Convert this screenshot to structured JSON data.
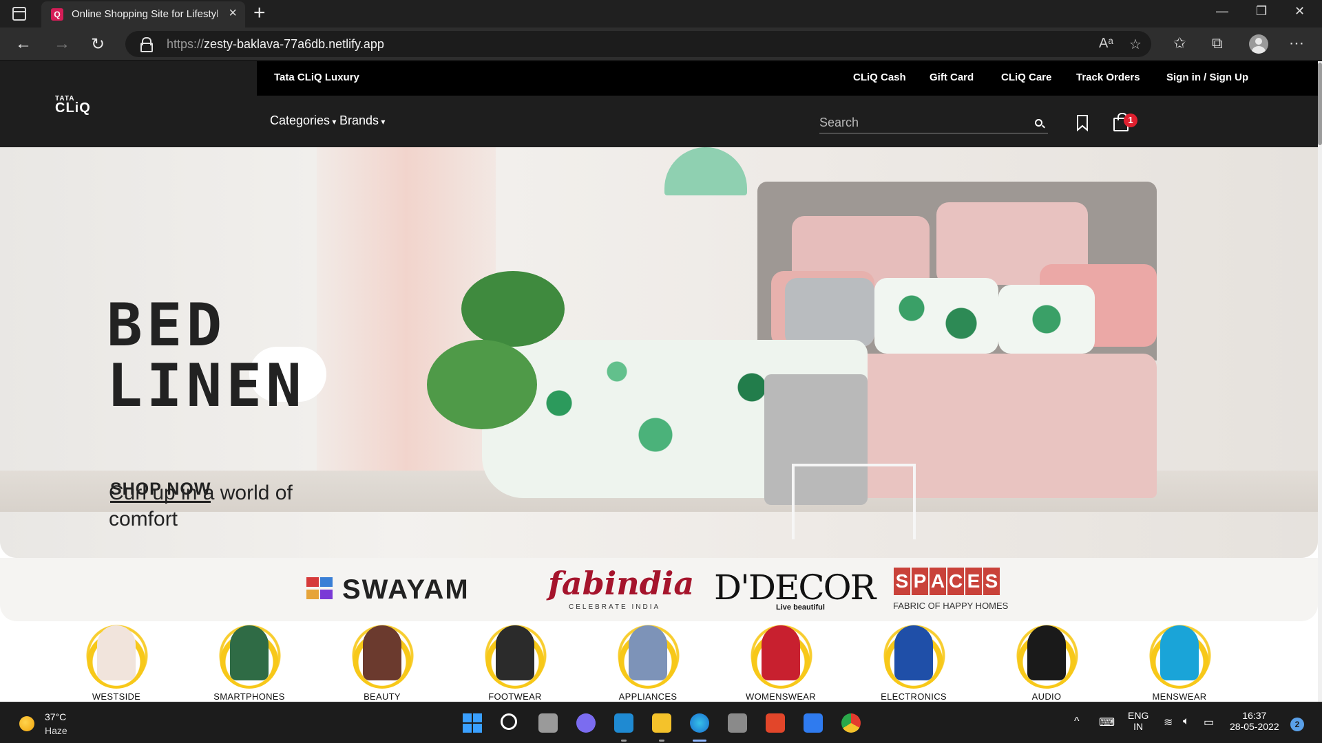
{
  "browser": {
    "tab_title": "Online Shopping Site for Lifestyle",
    "tab_close": "×",
    "new_tab": "+",
    "url_scheme": "https://",
    "url_host": "zesty-baklava-77a6db.netlify.app",
    "window_controls": {
      "minimize": "—",
      "restore": "❐",
      "close": "✕"
    },
    "nav": {
      "back": "←",
      "forward": "→",
      "reload": "↻"
    },
    "toolbar_icons": {
      "read_aloud": "Aᵃ",
      "add_favorite": "☆",
      "favorites": "✩",
      "collections": "⧉",
      "more": "⋯"
    }
  },
  "site": {
    "logo_top": "TATA",
    "logo_bottom": "CLiQ",
    "util_links": [
      "Tata CLiQ Luxury",
      "CLiQ Cash",
      "Gift Card",
      "CLiQ Care",
      "Track Orders",
      "Sign in / Sign Up"
    ],
    "nav_categories": "Categories",
    "nav_brands": "Brands",
    "search_placeholder": "Search",
    "bag_count": "1"
  },
  "hero": {
    "title_line1": "BED",
    "title_line2": "LINEN",
    "subtitle": "Curl up in a world of comfort",
    "cta": "SHOP NOW",
    "brands": {
      "swayam": "SWAYAM",
      "fabindia": "fabindia",
      "fabindia_tag": "CELEBRATE INDIA",
      "ddecor": "D'DECOR",
      "ddecor_tag": "Live beautiful",
      "spaces": [
        "S",
        "P",
        "A",
        "C",
        "E",
        "S"
      ],
      "spaces_tag": "FABRIC OF HAPPY HOMES"
    }
  },
  "categories": [
    {
      "label": "WESTSIDE",
      "color": "#f1e4dc"
    },
    {
      "label": "SMARTPHONES",
      "color": "#2f6b45"
    },
    {
      "label": "BEAUTY",
      "color": "#6b3a2e"
    },
    {
      "label": "FOOTWEAR",
      "color": "#2b2b2b"
    },
    {
      "label": "APPLIANCES",
      "color": "#7d93b8"
    },
    {
      "label": "WOMENSWEAR",
      "color": "#c8202f"
    },
    {
      "label": "ELECTRONICS",
      "color": "#1f4fa8"
    },
    {
      "label": "AUDIO",
      "color": "#1a1a1a"
    },
    {
      "label": "MENSWEAR",
      "color": "#1aa4d8"
    }
  ],
  "taskbar": {
    "temperature": "37°C",
    "condition": "Haze",
    "language_top": "ENG",
    "language_bottom": "IN",
    "time": "16:37",
    "date": "28-05-2022",
    "notifications": "2"
  }
}
